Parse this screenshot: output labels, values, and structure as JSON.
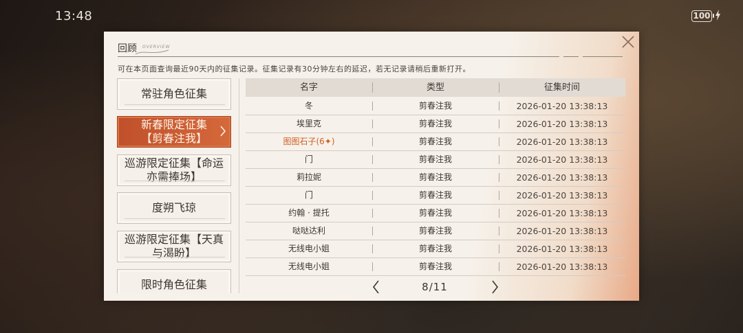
{
  "status_bar": {
    "time": "13:48",
    "battery": "100"
  },
  "dialog": {
    "title": "回顾",
    "title_sub": "OVERVIEW",
    "notice": "可在本页面查询最近90天内的征集记录。征集记录有30分钟左右的延迟，若无记录请稍后重新打开。"
  },
  "categories": [
    {
      "label": "常驻角色征集"
    },
    {
      "label": "新春限定征集【剪春注我】"
    },
    {
      "label": "巡游限定征集【命运亦需捧场】"
    },
    {
      "label": "度朔飞琼"
    },
    {
      "label": "巡游限定征集【天真与渴盼】"
    },
    {
      "label": "限时角色征集"
    }
  ],
  "table": {
    "headers": {
      "name": "名字",
      "type": "类型",
      "time": "征集时间"
    },
    "rows": [
      {
        "name": "冬",
        "type": "剪春注我",
        "time": "2026-01-20 13:38:13"
      },
      {
        "name": "埃里克",
        "type": "剪春注我",
        "time": "2026-01-20 13:38:13"
      },
      {
        "name": "图图石子(6✦)",
        "type": "剪春注我",
        "time": "2026-01-20 13:38:13"
      },
      {
        "name": "门",
        "type": "剪春注我",
        "time": "2026-01-20 13:38:13"
      },
      {
        "name": "莉拉妮",
        "type": "剪春注我",
        "time": "2026-01-20 13:38:13"
      },
      {
        "name": "门",
        "type": "剪春注我",
        "time": "2026-01-20 13:38:13"
      },
      {
        "name": "约翰 · 提托",
        "type": "剪春注我",
        "time": "2026-01-20 13:38:13"
      },
      {
        "name": "哒哒达利",
        "type": "剪春注我",
        "time": "2026-01-20 13:38:13"
      },
      {
        "name": "无线电小姐",
        "type": "剪春注我",
        "time": "2026-01-20 13:38:13"
      },
      {
        "name": "无线电小姐",
        "type": "剪春注我",
        "time": "2026-01-20 13:38:13"
      }
    ]
  },
  "pagination": {
    "label": "8/11"
  },
  "colors": {
    "accent": "#cf5f22",
    "active_bg": "#c85a30"
  }
}
